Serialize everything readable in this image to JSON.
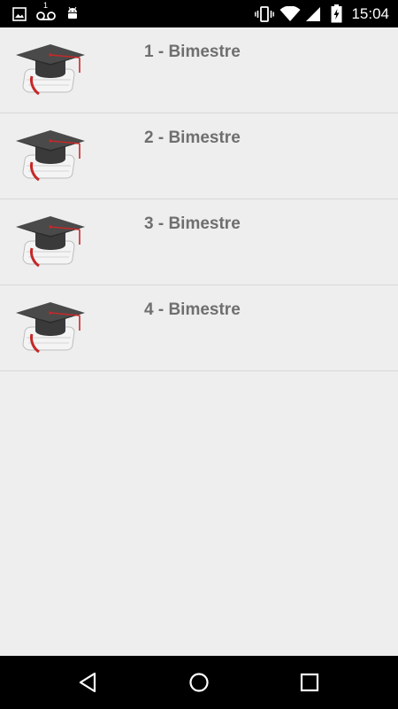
{
  "status_bar": {
    "time": "15:04",
    "voicemail_count": "1",
    "icons": [
      "image-icon",
      "voicemail-icon",
      "android-icon",
      "vibrate-icon",
      "wifi-icon",
      "signal-icon",
      "battery-charging-icon"
    ]
  },
  "list": {
    "items": [
      {
        "label": "1 - Bimestre",
        "icon": "graduation-cap-icon"
      },
      {
        "label": "2 - Bimestre",
        "icon": "graduation-cap-icon"
      },
      {
        "label": "3 - Bimestre",
        "icon": "graduation-cap-icon"
      },
      {
        "label": "4 - Bimestre",
        "icon": "graduation-cap-icon"
      }
    ]
  },
  "nav_bar": {
    "icons": [
      "back-icon",
      "home-icon",
      "recents-icon"
    ]
  },
  "colors": {
    "background": "#eeeeee",
    "label_text": "#6f6f6f",
    "divider": "#d7d7d7",
    "bar": "#000000"
  }
}
